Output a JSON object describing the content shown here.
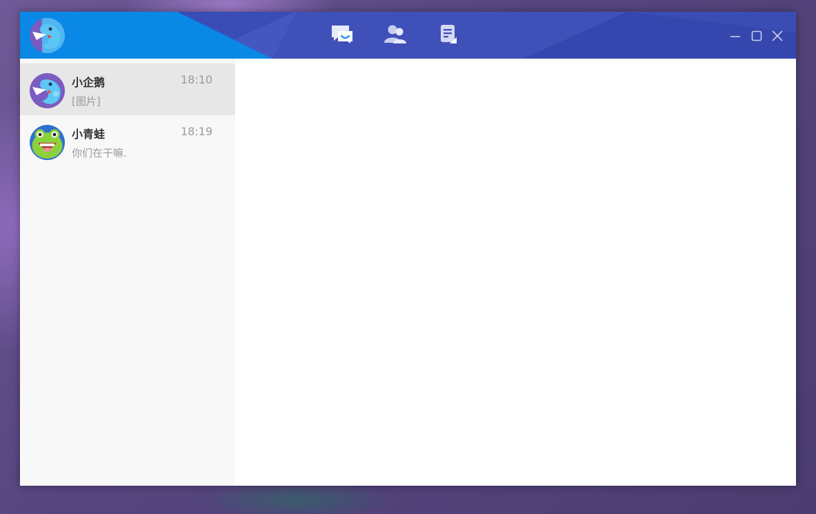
{
  "app": {
    "logo_icon": "penguin-logo-icon",
    "nav": [
      {
        "id": "chat",
        "icon": "chat-bubbles-icon"
      },
      {
        "id": "contacts",
        "icon": "contacts-icon"
      },
      {
        "id": "notes",
        "icon": "notes-icon"
      }
    ],
    "window_controls": [
      "minimize-icon",
      "maximize-icon",
      "close-icon"
    ]
  },
  "colors": {
    "titlebar_light": "#0a88e6",
    "titlebar_main": "#3f51b9",
    "titlebar_dark": "#3547ae",
    "sidebar_bg": "#f8f8f8",
    "selected_bg": "#e7e7e7"
  },
  "conversations": [
    {
      "name": "小企鹅",
      "time": "18:10",
      "preview": "[图片]",
      "avatar": "penguin-avatar-icon",
      "selected": true
    },
    {
      "name": "小青蛙",
      "time": "18:19",
      "preview": "你们在干嘛.",
      "avatar": "frog-avatar-icon",
      "selected": false
    }
  ]
}
